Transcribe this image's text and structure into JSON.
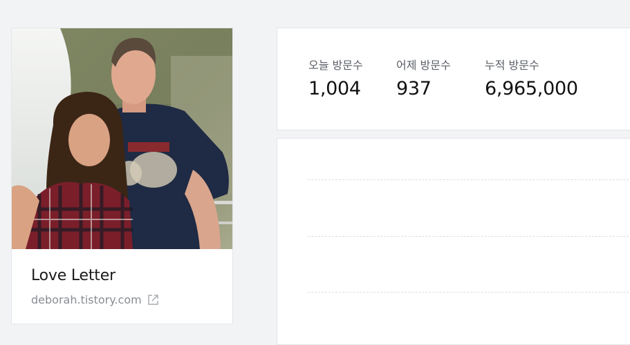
{
  "profile": {
    "blog_title": "Love Letter",
    "blog_url": "deborah.tistory.com",
    "photo_alt": "couple-photo"
  },
  "stats": {
    "today_label": "오늘 방문수",
    "today_value": "1,004",
    "yesterday_label": "어제 방문수",
    "yesterday_value": "937",
    "total_label": "누적 방문수",
    "total_value": "6,965,000"
  },
  "colors": {
    "background": "#f2f3f5",
    "card": "#ffffff",
    "border": "#e3e5e8",
    "muted_text": "#888c92"
  },
  "icons": {
    "external_link": "external-link-icon"
  }
}
